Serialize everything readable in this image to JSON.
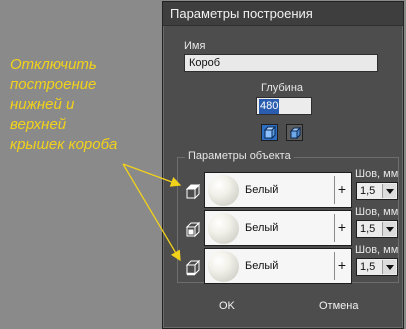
{
  "callout": {
    "lines": [
      "Отключить",
      "построение",
      "нижней и",
      "верхней",
      "крышек короба"
    ]
  },
  "dialog": {
    "title": "Параметры построения",
    "name_label": "Имя",
    "name_value": "Короб",
    "depth_label": "Глубина",
    "depth_value": "480",
    "group_title": "Параметры объекта",
    "rows": [
      {
        "material": "Белый",
        "plus": "+",
        "seam_label": "Шов, мм",
        "seam_value": "1,5"
      },
      {
        "material": "Белый",
        "plus": "+",
        "seam_label": "Шов, мм",
        "seam_value": "1,5"
      },
      {
        "material": "Белый",
        "plus": "+",
        "seam_label": "Шов, мм",
        "seam_value": "1,5"
      }
    ],
    "ok_label": "OK",
    "cancel_label": "Отмена"
  },
  "colors": {
    "callout_text": "#f2d21a",
    "dialog_bg": "#4d4d4d",
    "active_toggle": "#2e6fc4",
    "selection": "#2a5db0"
  },
  "icons": [
    "cube-top-icon",
    "cube-middle-icon",
    "cube-bottom-icon",
    "solid-box-icon",
    "box-outline-icon",
    "dropdown-arrow-icon"
  ]
}
